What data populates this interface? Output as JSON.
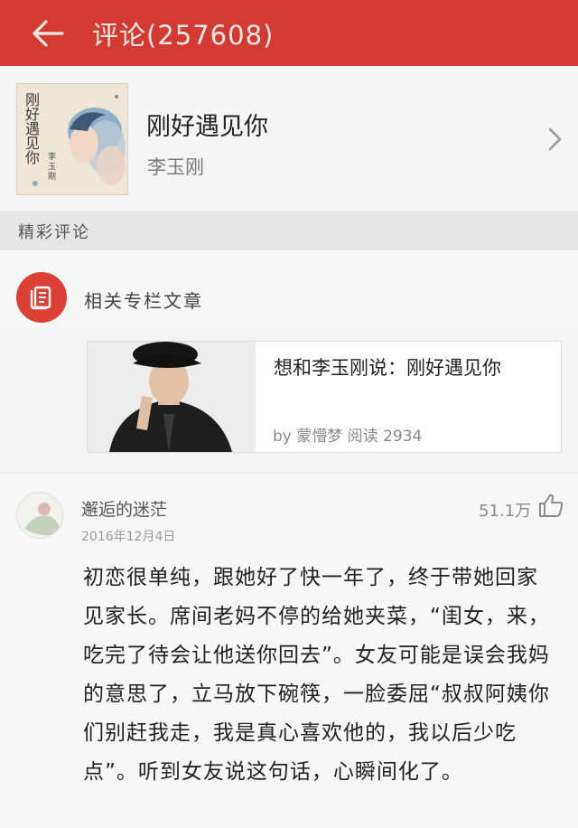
{
  "header": {
    "title": "评论(257608)",
    "back_icon": "arrow-left-icon",
    "background_color": "#d33a31"
  },
  "song": {
    "title": "刚好遇见你",
    "artist": "李玉刚",
    "cover_icon": "album-cover-image",
    "cover_text": "刚好遇见你",
    "cover_artist": "李玉刚"
  },
  "section": {
    "label": "精彩评论"
  },
  "related": {
    "label": "相关专栏文章",
    "icon": "article-icon",
    "accent_color": "#dc4034"
  },
  "article": {
    "title": "想和李玉刚说：刚好遇见你",
    "meta": "by 蒙懵梦  阅读 2934"
  },
  "comment": {
    "username": "邂逅的迷茫",
    "date": "2016年12月4日",
    "likes": "51.1万",
    "like_icon": "thumbs-up-icon",
    "body": "初恋很单纯，跟她好了快一年了，终于带她回家见家长。席间老妈不停的给她夹菜，“闺女，来，吃完了待会让他送你回去”。女友可能是误会我妈的意思了，立马放下碗筷，一脸委屈“叔叔阿姨你们别赶我走，我是真心喜欢他的，我以后少吃点”。听到女友说这句话，心瞬间化了。"
  }
}
